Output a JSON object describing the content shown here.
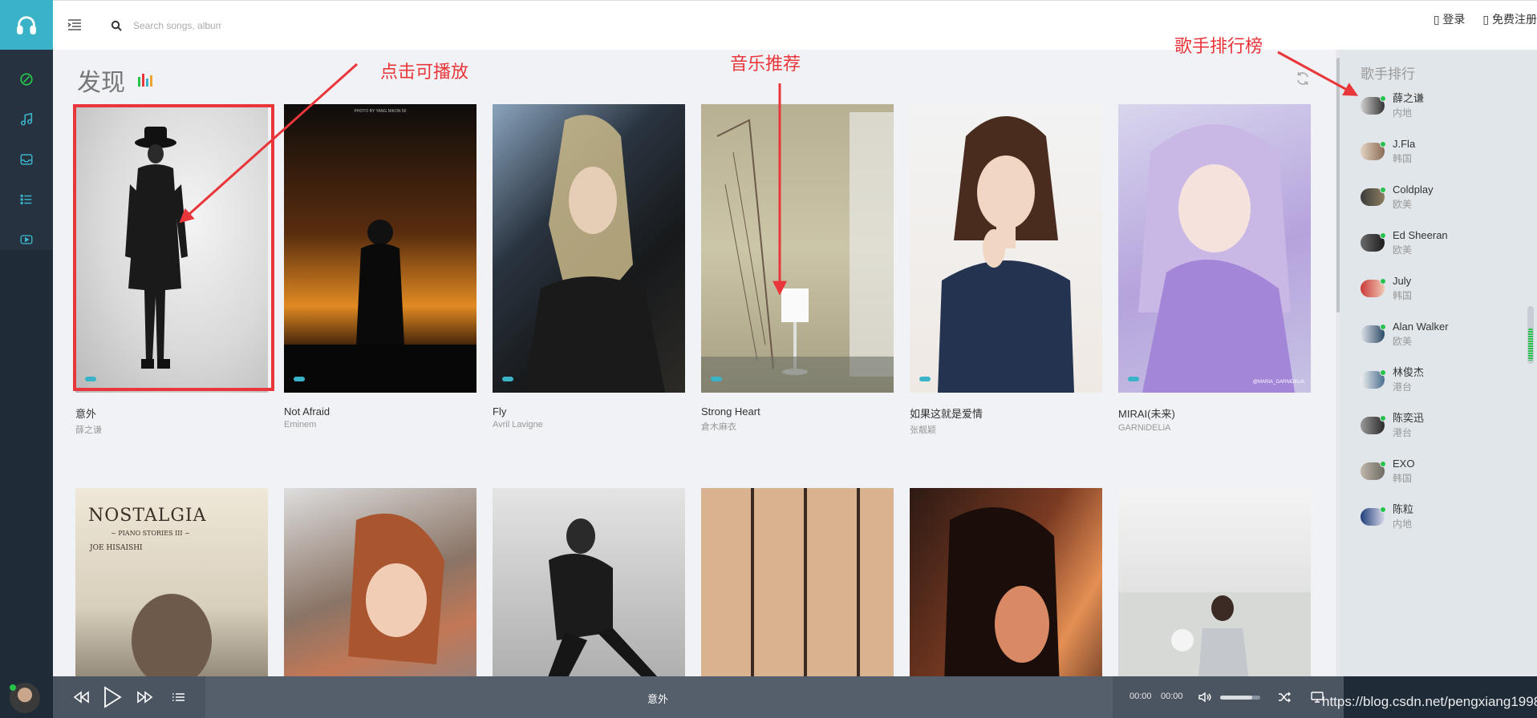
{
  "header": {
    "search_placeholder": "Search songs, albums",
    "login": "▯ 登录",
    "register": "▯ 免费注册"
  },
  "main": {
    "title": "发现",
    "cards": [
      {
        "song": "意外",
        "artist": "薛之谦"
      },
      {
        "song": "Not Afraid",
        "artist": "Eminem"
      },
      {
        "song": "Fly",
        "artist": "Avril Lavigne"
      },
      {
        "song": "Strong Heart",
        "artist": "倉木麻衣"
      },
      {
        "song": "如果这就是爱情",
        "artist": "张靓颖"
      },
      {
        "song": "MIRAI(未来)",
        "artist": "GARNiDELiA"
      },
      {
        "song": "",
        "artist": ""
      },
      {
        "song": "",
        "artist": ""
      },
      {
        "song": "",
        "artist": ""
      },
      {
        "song": "",
        "artist": ""
      },
      {
        "song": "",
        "artist": ""
      },
      {
        "song": "",
        "artist": ""
      }
    ],
    "cover_texts": {
      "photo_credit": "PHOTO BY YANG NIKON 50",
      "nostalgia_title": "NOSTALGIA",
      "nostalgia_subtitle": "~ PIANO STORIES III ~",
      "nostalgia_artist": "JOE HISAISHI",
      "mirai_watermark": "@MARIA_GARNiDELiA"
    }
  },
  "sidebar": {
    "title": "歌手排行",
    "singers": [
      {
        "name": "薛之谦",
        "region": "内地"
      },
      {
        "name": "J.Fla",
        "region": "韩国"
      },
      {
        "name": "Coldplay",
        "region": "欧美"
      },
      {
        "name": "Ed Sheeran",
        "region": "欧美"
      },
      {
        "name": "July",
        "region": "韩国"
      },
      {
        "name": "Alan Walker",
        "region": "欧美"
      },
      {
        "name": "林俊杰",
        "region": "港台"
      },
      {
        "name": "陈奕迅",
        "region": "港台"
      },
      {
        "name": "EXO",
        "region": "韩国"
      },
      {
        "name": "陈粒",
        "region": "内地"
      }
    ]
  },
  "player": {
    "now_playing": "意外",
    "current_time": "00:00",
    "duration": "00:00",
    "volume_level": 0.8
  },
  "annotations": {
    "play_hint": "点击可播放",
    "recommend_hint": "音乐推荐",
    "ranking_hint": "歌手排行榜"
  },
  "watermark": "https://blog.csdn.net/pengxiang1998",
  "colors": {
    "accent": "#3ab2c8",
    "nav_bg": "#1f2b37",
    "player_bg": "#555f6c",
    "online": "#27c24c",
    "annotation": "#e8363a"
  }
}
